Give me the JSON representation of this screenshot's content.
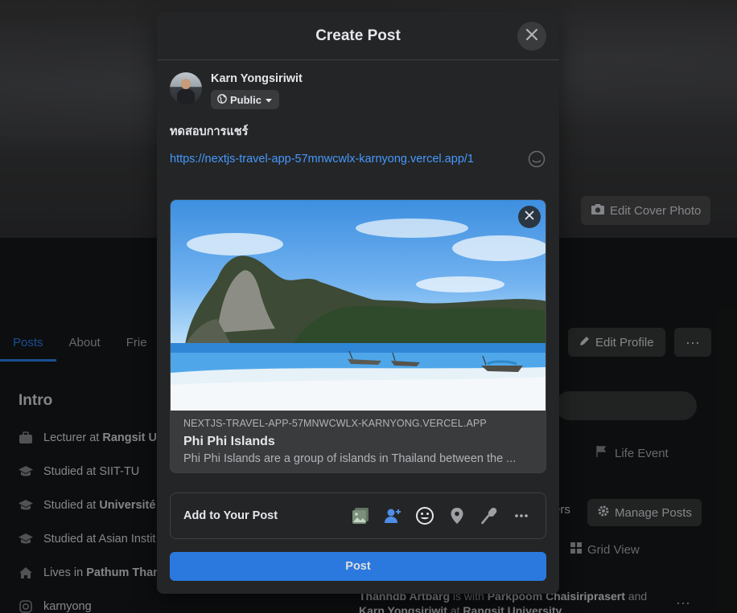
{
  "background": {
    "edit_cover_label": "Edit Cover Photo",
    "tabs": [
      {
        "label": "Posts"
      },
      {
        "label": "About"
      },
      {
        "label": "Frie"
      }
    ],
    "edit_profile_label": "Edit Profile",
    "intro_title": "Intro",
    "intro_items": [
      {
        "prefix": "Lecturer at ",
        "bold": "Rangsit U",
        "icon": "briefcase-icon"
      },
      {
        "prefix": "Studied at SIIT-TU",
        "bold": "",
        "icon": "graduation-cap-icon"
      },
      {
        "prefix": "Studied at ",
        "bold": "Université",
        "icon": "graduation-cap-icon"
      },
      {
        "prefix": "Studied at Asian Instit",
        "bold": "",
        "icon": "graduation-cap-icon"
      },
      {
        "prefix": "Lives in ",
        "bold": "Pathum Than",
        "icon": "home-icon"
      },
      {
        "prefix": "karnyong",
        "bold": "",
        "icon": "instagram-icon"
      }
    ],
    "life_event_label": "Life Event",
    "filters_label": "ers",
    "manage_posts_label": "Manage Posts",
    "grid_view_label": "Grid View",
    "feed_line1_name": "Thanhdb Artbarg",
    "feed_line1_mid": " is with ",
    "feed_line1_with": "Parkpoom Chaisiriprasert",
    "feed_line1_end": " and",
    "feed_line2_name": "Karn Yongsiriwit",
    "feed_line2_mid": " at ",
    "feed_line2_place": "Rangsit University"
  },
  "modal": {
    "title": "Create Post",
    "author_name": "Karn Yongsiriwit",
    "privacy_label": "Public",
    "post_text": "ทดสอบการแชร์",
    "post_link": "https://nextjs-travel-app-57mnwcwlx-karnyong.vercel.app/1",
    "preview": {
      "domain": "NEXTJS-TRAVEL-APP-57MNWCWLX-KARNYONG.VERCEL.APP",
      "title": "Phi Phi Islands",
      "description": "Phi Phi Islands are a group of islands in Thailand between the ..."
    },
    "add_to_post_label": "Add to Your Post",
    "add_icons": [
      "photo-video-icon",
      "tag-people-icon",
      "feeling-icon",
      "check-in-icon",
      "live-video-icon",
      "more-icon"
    ],
    "post_button_label": "Post",
    "colors": {
      "accent": "#2d88ff",
      "link": "#4599ff",
      "photo": "#45bd62",
      "tag": "#1877f2",
      "feeling": "#f7b928",
      "location": "#f5533d"
    }
  }
}
